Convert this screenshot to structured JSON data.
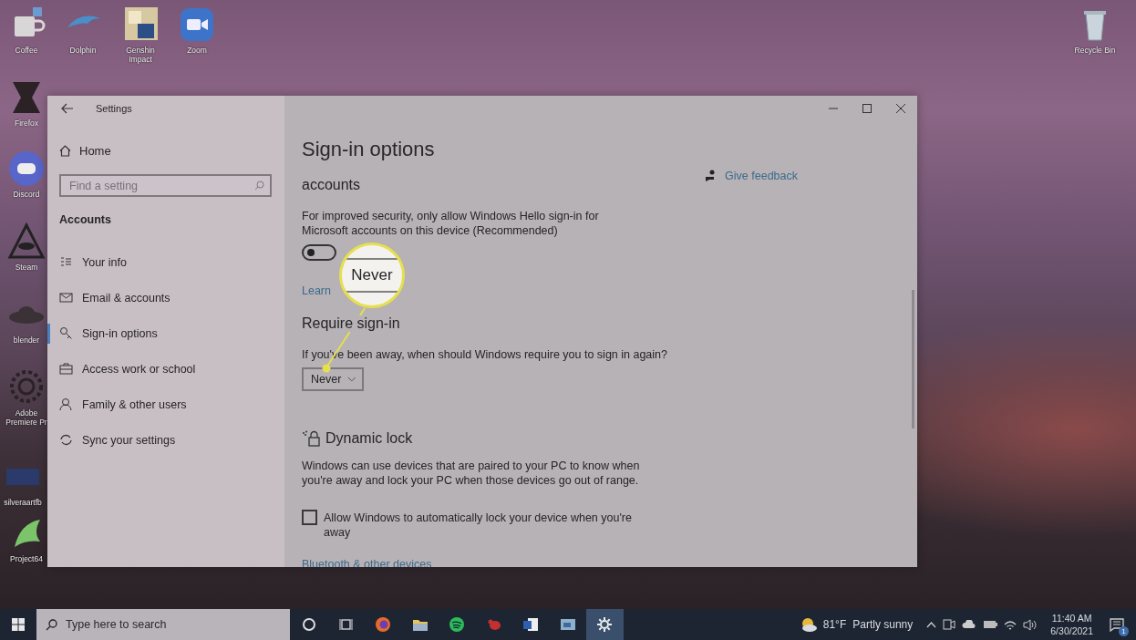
{
  "desktop": {
    "icons": [
      {
        "label": "Coffee"
      },
      {
        "label": "Dolphin"
      },
      {
        "label": "Genshin Impact"
      },
      {
        "label": "Zoom"
      },
      {
        "label": "Firefox"
      },
      {
        "label": "Discord"
      },
      {
        "label": "Steam"
      },
      {
        "label": "blender"
      },
      {
        "label": "Adobe Premiere Pr"
      },
      {
        "label": "silveraartfb"
      },
      {
        "label": "Project64"
      },
      {
        "label": "Recycle Bin"
      }
    ]
  },
  "window": {
    "title": "Settings",
    "sidebar": {
      "home": "Home",
      "search": {
        "placeholder": "Find a setting"
      },
      "section": "Accounts",
      "items": [
        {
          "label": "Your info",
          "selected": false
        },
        {
          "label": "Email & accounts",
          "selected": false
        },
        {
          "label": "Sign-in options",
          "selected": true
        },
        {
          "label": "Access work or school",
          "selected": false
        },
        {
          "label": "Family & other users",
          "selected": false
        },
        {
          "label": "Sync your settings",
          "selected": false
        }
      ]
    },
    "content": {
      "title": "Sign-in options",
      "hello": {
        "heading": "accounts",
        "description": "For improved security, only allow Windows Hello sign-in for Microsoft accounts on this device (Recommended)",
        "toggle": {
          "on": false
        },
        "link": "Learn"
      },
      "require": {
        "heading": "Require sign-in",
        "question": "If you've been away, when should Windows require you to sign in again?",
        "dropdown": {
          "value": "Never"
        }
      },
      "dynamic_lock": {
        "heading": "Dynamic lock",
        "description": "Windows can use devices that are paired to your PC to know when you're away and lock your PC when those devices go out of range.",
        "checkbox": {
          "label": "Allow Windows to automatically lock your device when you're away",
          "checked": false
        },
        "link": "Bluetooth & other devices"
      },
      "feedback": "Give feedback"
    }
  },
  "callout": {
    "text": "Never"
  },
  "taskbar": {
    "search": {
      "placeholder": "Type here to search"
    },
    "weather": {
      "temperature": "81°F",
      "condition": "Partly sunny"
    },
    "time": "11:40 AM",
    "date": "6/30/2021",
    "notifications": "1"
  }
}
